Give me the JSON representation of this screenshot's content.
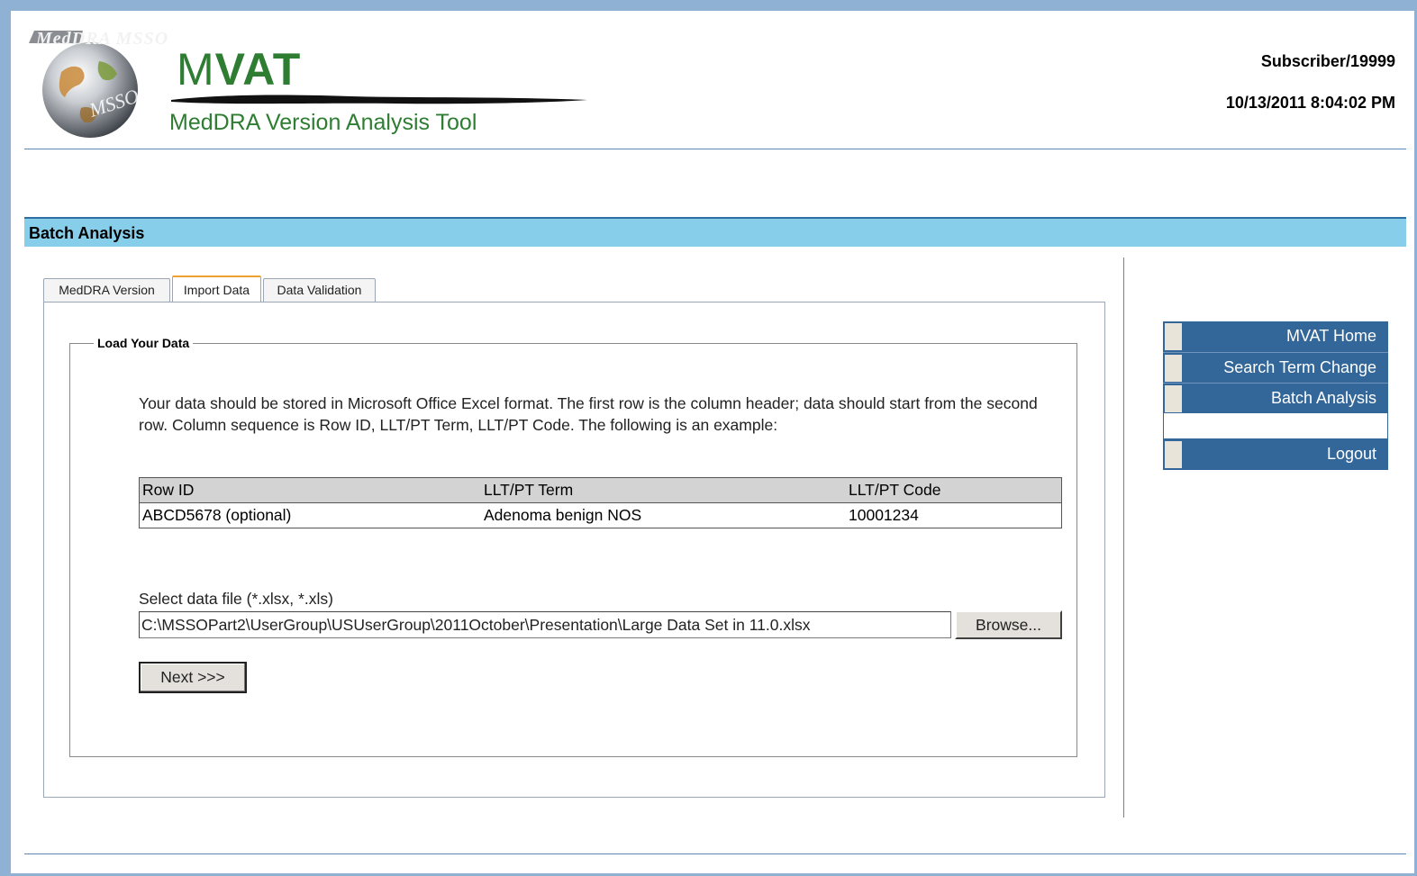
{
  "header": {
    "logo_text": "MedDRA MSSO",
    "brand_light": "M",
    "brand_bold": "VAT",
    "brand_subtitle": "MedDRA Version Analysis Tool",
    "user": "Subscriber/19999",
    "datetime": "10/13/2011 8:04:02 PM"
  },
  "section": {
    "title": "Batch Analysis"
  },
  "tabs": [
    {
      "label": "MedDRA Version",
      "active": false
    },
    {
      "label": "Import Data",
      "active": true
    },
    {
      "label": "Data Validation",
      "active": false
    }
  ],
  "load": {
    "legend": "Load Your Data",
    "instructions": "Your data should be stored in Microsoft Office Excel format. The first row is the column header; data should start from the second row. Column sequence is Row ID, LLT/PT Term, LLT/PT Code. The following is an example:",
    "table": {
      "headers": [
        "Row ID",
        "LLT/PT Term",
        "LLT/PT Code"
      ],
      "rows": [
        [
          "ABCD5678 (optional)",
          "Adenoma benign NOS",
          "10001234"
        ]
      ]
    },
    "file_label": "Select data file (*.xlsx, *.xls)",
    "file_value": "C:\\MSSOPart2\\UserGroup\\USUserGroup\\2011October\\Presentation\\Large Data Set in 11.0.xlsx",
    "browse_label": "Browse...",
    "next_label": "Next >>>"
  },
  "nav": {
    "home": "MVAT Home",
    "search": "Search Term Change",
    "batch": "Batch Analysis",
    "logout": "Logout"
  },
  "colors": {
    "brand_green": "#2e7d32",
    "nav_blue": "#336699",
    "section_bar": "#87ceeb"
  }
}
